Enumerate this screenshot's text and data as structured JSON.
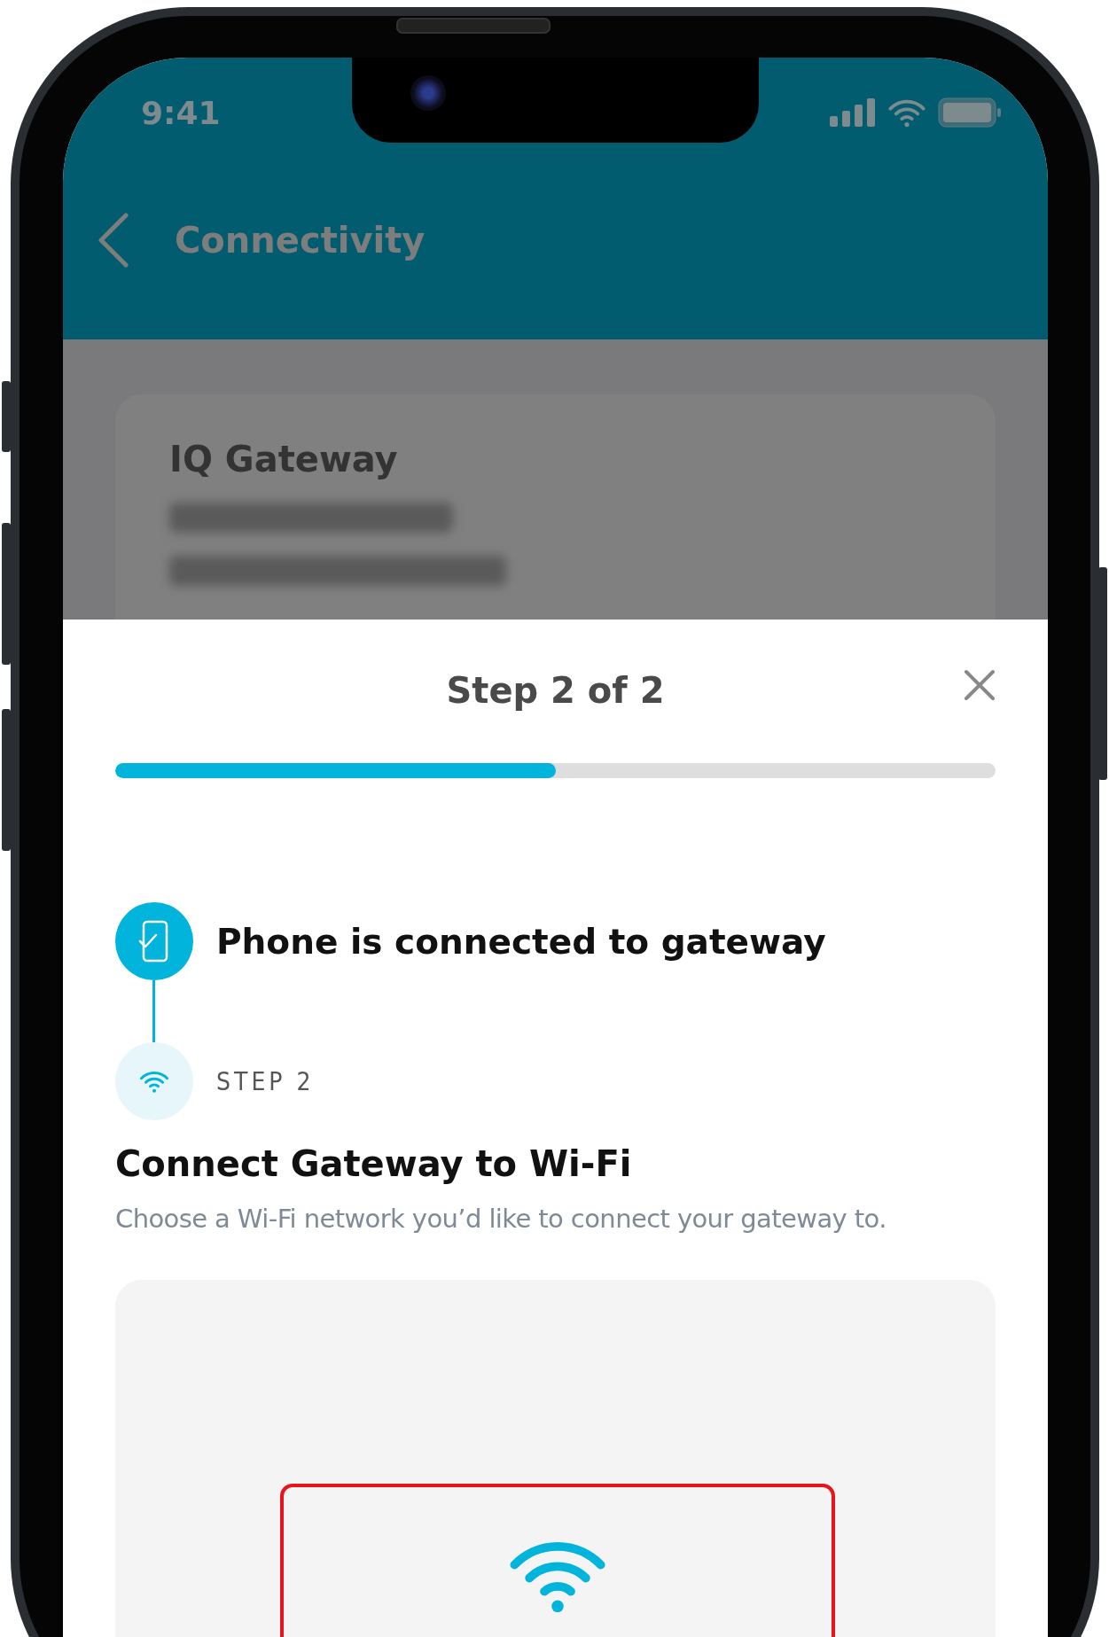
{
  "status_bar": {
    "time": "9:41"
  },
  "header": {
    "title": "Connectivity"
  },
  "device_card": {
    "name": "IQ Gateway"
  },
  "sheet": {
    "title": "Step 2 of 2",
    "progress": {
      "level": 0.5
    },
    "steps": [
      {
        "kind": "done",
        "title": "Phone is connected to gateway"
      },
      {
        "kind": "current",
        "label": "STEP 2",
        "title": "Connect Gateway to Wi-Fi",
        "description": "Choose a Wi-Fi network you’d like to connect your gateway to."
      }
    ]
  }
}
